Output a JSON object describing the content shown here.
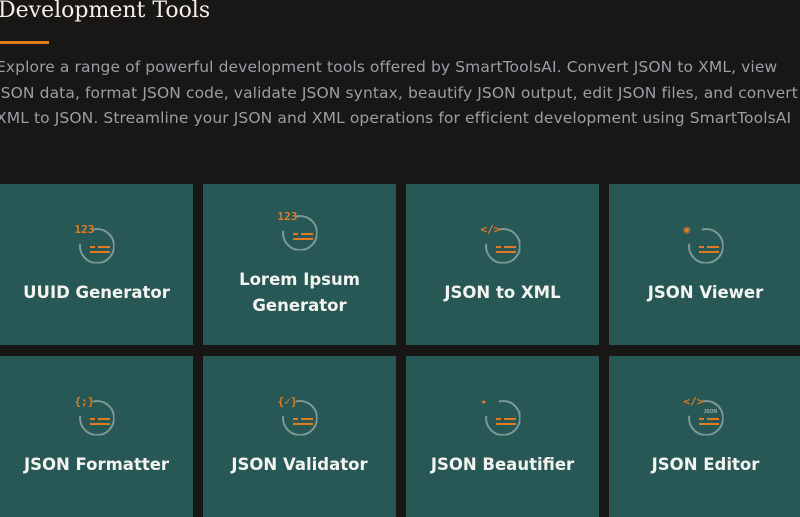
{
  "header": {
    "title": "Development Tools",
    "description": "Explore a range of powerful development tools offered by SmartToolsAI. Convert JSON to XML, view JSON data, format JSON code, validate JSON syntax, beautify JSON output, edit JSON files, and convert XML to JSON. Streamline your JSON and XML operations for efficient development using SmartToolsAI"
  },
  "accent_color": "#e07b20",
  "card_color": "#275856",
  "tools": [
    {
      "label": "UUID Generator",
      "icon": "number-123-icon",
      "glyph": "123"
    },
    {
      "label": "Lorem Ipsum Generator",
      "icon": "number-123-icon",
      "glyph": "123"
    },
    {
      "label": "JSON to XML",
      "icon": "code-tag-icon",
      "glyph": "</>"
    },
    {
      "label": "JSON Viewer",
      "icon": "eye-icon",
      "glyph": "◉"
    },
    {
      "label": "JSON Formatter",
      "icon": "braces-icon",
      "glyph": "{;}"
    },
    {
      "label": "JSON Validator",
      "icon": "braces-check-icon",
      "glyph": "{✓}"
    },
    {
      "label": "JSON Beautifier",
      "icon": "sparkles-icon",
      "glyph": "✦"
    },
    {
      "label": "JSON Editor",
      "icon": "code-tag-icon",
      "glyph": "</>",
      "sub": "JSON"
    }
  ]
}
